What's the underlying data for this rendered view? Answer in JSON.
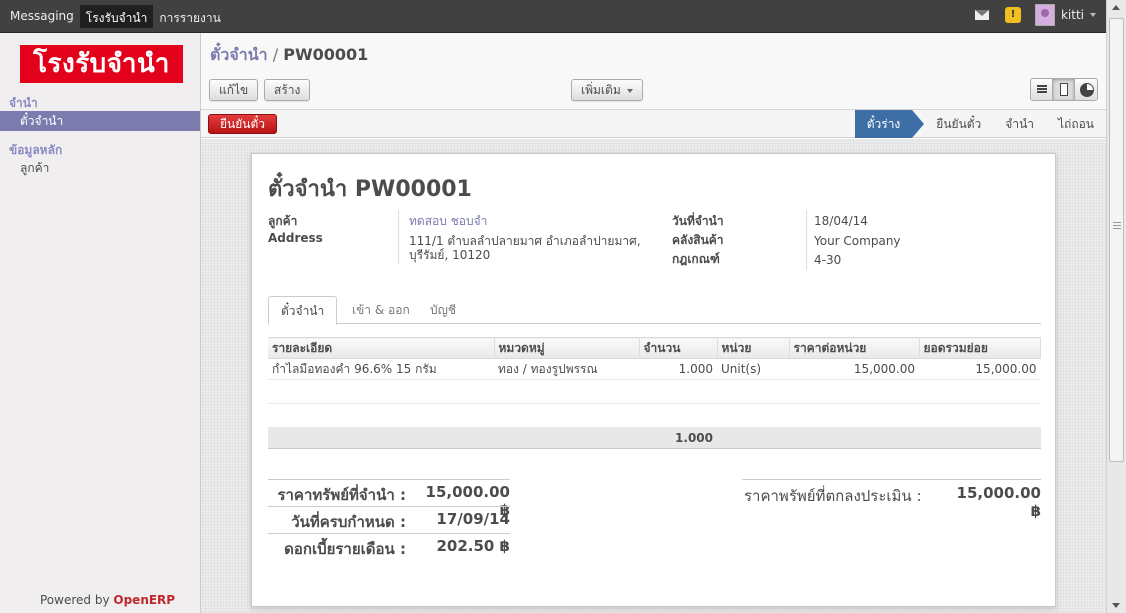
{
  "topbar": {
    "menu": [
      "Messaging",
      "โรงรับจำนำ",
      "การรายงาน"
    ],
    "user": "kitti",
    "warning_symbol": "!"
  },
  "sidebar": {
    "logo": "โรงรับจำนำ",
    "sections": [
      {
        "title": "จำนำ",
        "items": [
          "ตั๋วจำนำ"
        ]
      },
      {
        "title": "ข้อมูลหลัก",
        "items": [
          "ลูกค้า"
        ]
      }
    ],
    "powered_by": "Powered by",
    "powered_brand": "OpenERP"
  },
  "header": {
    "breadcrumb_parent": "ตั๋วจำนำ",
    "breadcrumb_sep": "/",
    "breadcrumb_current": "PW00001",
    "edit_label": "แก้ไข",
    "create_label": "สร้าง",
    "more_label": "เพิ่มเติม"
  },
  "statusbar": {
    "action_label": "ยืนยันตั๋ว",
    "stages": [
      "ตั๋วร่าง",
      "ยืนยันตั๋ว",
      "จำนำ",
      "ไถ่ถอน"
    ],
    "active_stage": "ตั๋วร่าง"
  },
  "form": {
    "title": "ตั๋วจำนำ PW00001",
    "customer_label": "ลูกค้า",
    "customer_value": "ทดสอบ ชอบจำ",
    "address_label": "Address",
    "address_line1": "111/1 ตำบลลำปลายมาศ อำเภอลำปายมาศ,",
    "address_line2": "บุรีรัมย์, 10120",
    "date_label": "วันที่จำนำ",
    "date_value": "18/04/14",
    "warehouse_label": "คลังสินค้า",
    "warehouse_value": "Your Company",
    "rule_label": "กฎเกณฑ์",
    "rule_value": "4-30",
    "tabs": [
      "ตั๋วจำนำ",
      "เข้า & ออก",
      "บัญชี"
    ],
    "active_tab": "ตั๋วจำนำ"
  },
  "lines": {
    "columns": [
      "รายละเอียด",
      "หมวดหมู่",
      "จำนวน",
      "หน่วย",
      "ราคาต่อหน่วย",
      "ยอดรวมย่อย"
    ],
    "rows": [
      [
        "กำไลมือทองคำ 96.6% 15 กรัม",
        "ทอง / ทองรูปพรรณ",
        "1.000",
        "Unit(s)",
        "15,000.00",
        "15,000.00"
      ]
    ],
    "total_qty": "1.000"
  },
  "summary": {
    "asset_price_label": "ราคาทรัพย์ที่จำนำ :",
    "asset_price_value": "15,000.00 ฿",
    "due_date_label": "วันที่ครบกำหนด :",
    "due_date_value": "17/09/14",
    "monthly_interest_label": "ดอกเบี้ยรายเดือน :",
    "monthly_interest_value": "202.50 ฿",
    "appraised_label": "ราคาพรัพย์ที่ตกลงประเมิน :",
    "appraised_value": "15,000.00 ฿"
  }
}
